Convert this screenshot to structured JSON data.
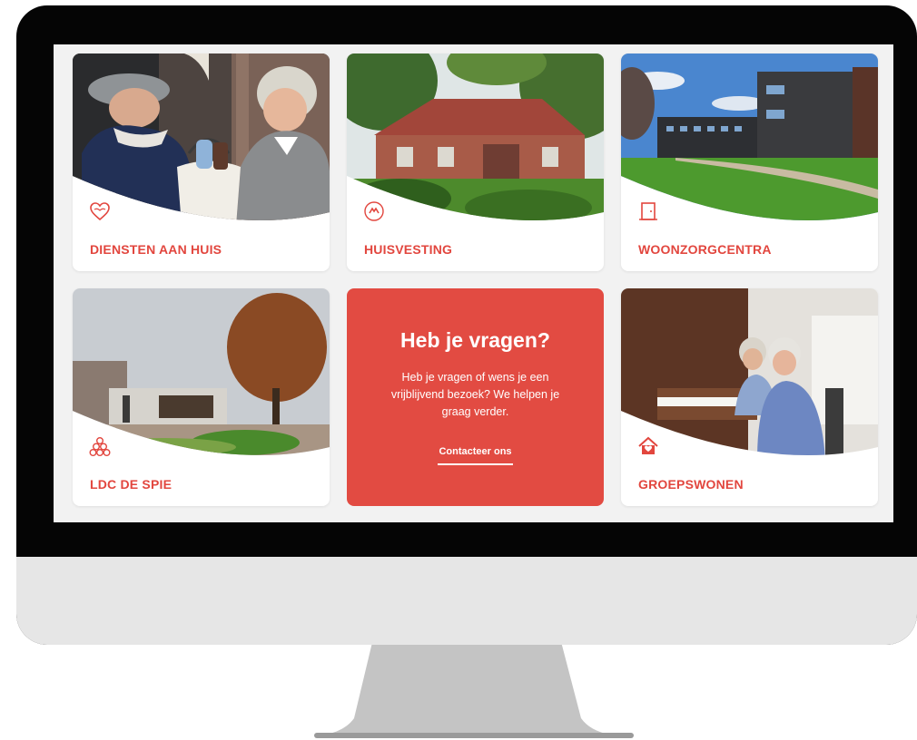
{
  "cards": [
    {
      "label": "DIENSTEN AAN HUIS",
      "icon": "heart-icon"
    },
    {
      "label": "HUISVESTING",
      "icon": "house-hands-icon"
    },
    {
      "label": "WOONZORGCENTRA",
      "icon": "door-icon"
    },
    {
      "label": "LDC DE SPIE",
      "icon": "circles-icon"
    },
    {
      "label": "GROEPSWONEN",
      "icon": "house-heart-icon"
    }
  ],
  "contact": {
    "title": "Heb je vragen?",
    "body": "Heb je vragen of wens je een vrijblijvend bezoek? We helpen je graag verder.",
    "link": "Contacteer ons"
  },
  "colors": {
    "accent": "#e2463e",
    "cta_background": "#e24b42"
  }
}
